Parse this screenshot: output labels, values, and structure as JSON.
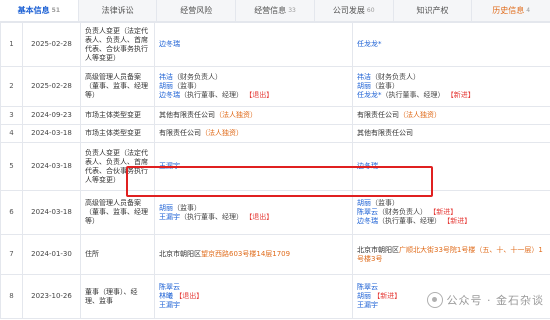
{
  "tabs": [
    {
      "label": "基本信息",
      "count": "51",
      "state": "active"
    },
    {
      "label": "法律诉讼",
      "count": "",
      "state": ""
    },
    {
      "label": "经营风险",
      "count": "",
      "state": ""
    },
    {
      "label": "经营信息",
      "count": "33",
      "state": ""
    },
    {
      "label": "公司发展",
      "count": "60",
      "state": ""
    },
    {
      "label": "知识产权",
      "count": "",
      "state": ""
    },
    {
      "label": "历史信息",
      "count": "4",
      "state": "last"
    }
  ],
  "rows": [
    {
      "index": "1",
      "date": "2025-02-28",
      "item": "负责人变更（法定代表人、负责人、首席代表、合伙事务执行人等变更）",
      "before": [
        {
          "name": "边冬瑞"
        }
      ],
      "after": [
        {
          "name": "任龙龙*"
        }
      ]
    },
    {
      "index": "2",
      "date": "2025-02-28",
      "item": "高级管理人员备案（董事、监事、经理等）",
      "before": [
        {
          "name": "祎洁",
          "role": "（财务负责人）"
        },
        {
          "name": "胡丽",
          "role": "（监事）"
        },
        {
          "name": "边冬瑞",
          "role": "（执行董事、经理）",
          "tag": "退出"
        }
      ],
      "after": [
        {
          "name": "祎洁",
          "role": "（财务负责人）"
        },
        {
          "name": "胡丽",
          "role": "（监事）"
        },
        {
          "name": "任龙龙*",
          "role": "（执行董事、经理）",
          "tag": "新进"
        }
      ]
    },
    {
      "index": "3",
      "date": "2024-09-23",
      "item": "市场主体类型变更",
      "before": [
        {
          "plain": "其他有限责任公司",
          "tag": "法人独资"
        }
      ],
      "after": [
        {
          "plain": "有限责任公司",
          "tag": "法人独资"
        }
      ]
    },
    {
      "index": "4",
      "date": "2024-03-18",
      "item": "市场主体类型变更",
      "before": [
        {
          "plain": "有限责任公司",
          "tag": "法人独资"
        }
      ],
      "after": [
        {
          "plain": "其他有限责任公司"
        }
      ]
    },
    {
      "index": "5",
      "date": "2024-03-18",
      "item": "负责人变更（法定代表人、负责人、首席代表、合伙事务执行人等变更）",
      "before": [
        {
          "name": "王漏宇"
        }
      ],
      "after": [
        {
          "name": "边冬瑞"
        }
      ]
    },
    {
      "index": "6",
      "date": "2024-03-18",
      "item": "高级管理人员备案（董事、监事、经理等）",
      "before": [
        {
          "name": "胡丽",
          "role": "（监事）"
        },
        {
          "name": "王漏宇",
          "role": "（执行董事、经理）",
          "tag": "退出"
        }
      ],
      "after": [
        {
          "name": "胡丽",
          "role": "（监事）"
        },
        {
          "name": "陈翠云",
          "role": "（财务负责人）",
          "tag": "新进"
        },
        {
          "name": "边冬瑞",
          "role": "（执行董事、经理）",
          "tag": "新进"
        }
      ]
    },
    {
      "index": "7",
      "date": "2024-01-30",
      "item": "住所",
      "before_address": {
        "prefix": "北京市朝阳区",
        "highlight": "望京西路603号楼14层1709",
        "suffix": ""
      },
      "after_address": {
        "prefix": "北京市朝阳区",
        "highlight": "广顺北大街33号院1号楼（五、十、十一层）1号楼",
        "suffix": "3号"
      }
    },
    {
      "index": "8",
      "date": "2023-10-26",
      "item": "董事（理事）、经理、监事",
      "before": [
        {
          "name": "陈翠云",
          "role": ""
        },
        {
          "name": "林曦",
          "role": "",
          "tag": "退出"
        },
        {
          "name": "王漏宇",
          "role": ""
        }
      ],
      "after": [
        {
          "name": "陈翠云",
          "role": ""
        },
        {
          "name": "胡丽",
          "role": "",
          "tag": "新进"
        },
        {
          "name": "王漏宇",
          "role": ""
        }
      ]
    }
  ],
  "watermark": "公众号 · 金石杂谈",
  "colors": {
    "link": "#1a5fd4",
    "highlight_border": "#e02020",
    "tag": "#e53935",
    "accent": "#e06c1c"
  }
}
